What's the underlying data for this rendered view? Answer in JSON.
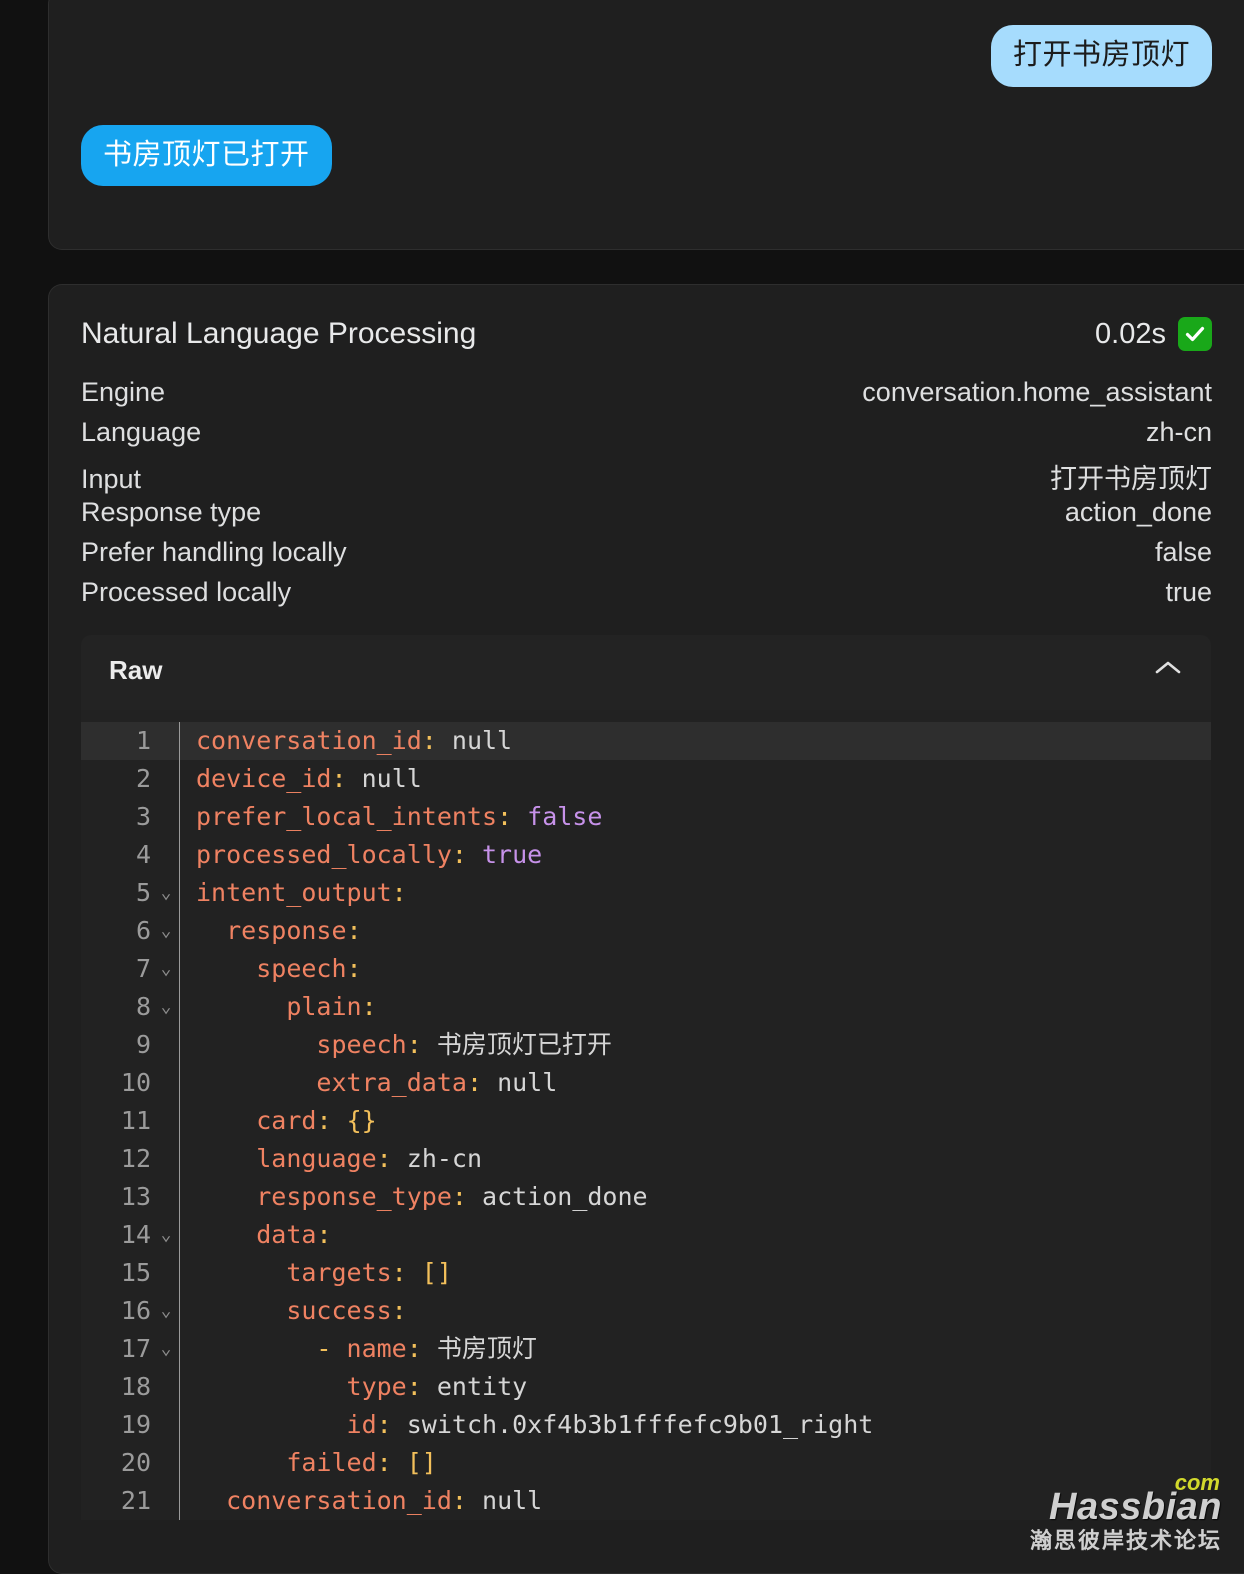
{
  "conversation": {
    "messages": [
      {
        "role": "user",
        "text": "打开书房顶灯"
      },
      {
        "role": "assistant",
        "text": "书房顶灯已打开"
      }
    ]
  },
  "nlp": {
    "title": "Natural Language Processing",
    "duration": "0.02s",
    "status_icon": "check-badge-icon",
    "status_color": "#19a819",
    "rows": [
      {
        "label": "Engine",
        "value": "conversation.home_assistant"
      },
      {
        "label": "Language",
        "value": "zh-cn"
      },
      {
        "label": "Input",
        "value": "打开书房顶灯"
      },
      {
        "label": "Response type",
        "value": "action_done"
      },
      {
        "label": "Prefer handling locally",
        "value": "false"
      },
      {
        "label": "Processed locally",
        "value": "true"
      }
    ],
    "raw": {
      "title": "Raw",
      "toggle_icon": "chevron-up-icon",
      "expanded": true,
      "lines": [
        {
          "n": "1",
          "fold": false,
          "highlight": true,
          "text": "conversation_id: null"
        },
        {
          "n": "2",
          "fold": false,
          "highlight": false,
          "text": "device_id: null"
        },
        {
          "n": "3",
          "fold": false,
          "highlight": false,
          "text": "prefer_local_intents: false"
        },
        {
          "n": "4",
          "fold": false,
          "highlight": false,
          "text": "processed_locally: true"
        },
        {
          "n": "5",
          "fold": true,
          "highlight": false,
          "text": "intent_output:"
        },
        {
          "n": "6",
          "fold": true,
          "highlight": false,
          "text": "  response:"
        },
        {
          "n": "7",
          "fold": true,
          "highlight": false,
          "text": "    speech:"
        },
        {
          "n": "8",
          "fold": true,
          "highlight": false,
          "text": "      plain:"
        },
        {
          "n": "9",
          "fold": false,
          "highlight": false,
          "text": "        speech: 书房顶灯已打开"
        },
        {
          "n": "10",
          "fold": false,
          "highlight": false,
          "text": "        extra_data: null"
        },
        {
          "n": "11",
          "fold": false,
          "highlight": false,
          "text": "    card: {}"
        },
        {
          "n": "12",
          "fold": false,
          "highlight": false,
          "text": "    language: zh-cn"
        },
        {
          "n": "13",
          "fold": false,
          "highlight": false,
          "text": "    response_type: action_done"
        },
        {
          "n": "14",
          "fold": true,
          "highlight": false,
          "text": "    data:"
        },
        {
          "n": "15",
          "fold": false,
          "highlight": false,
          "text": "      targets: []"
        },
        {
          "n": "16",
          "fold": true,
          "highlight": false,
          "text": "      success:"
        },
        {
          "n": "17",
          "fold": true,
          "highlight": false,
          "text": "        - name: 书房顶灯"
        },
        {
          "n": "18",
          "fold": false,
          "highlight": false,
          "text": "          type: entity"
        },
        {
          "n": "19",
          "fold": false,
          "highlight": false,
          "text": "          id: switch.0xf4b3b1fffefc9b01_right"
        },
        {
          "n": "20",
          "fold": false,
          "highlight": false,
          "text": "      failed: []"
        },
        {
          "n": "21",
          "fold": false,
          "highlight": false,
          "text": "  conversation_id: null"
        }
      ]
    }
  },
  "watermark": {
    "main": "Hassbian",
    "tld": "com",
    "sub": "瀚思彼岸技术论坛"
  }
}
